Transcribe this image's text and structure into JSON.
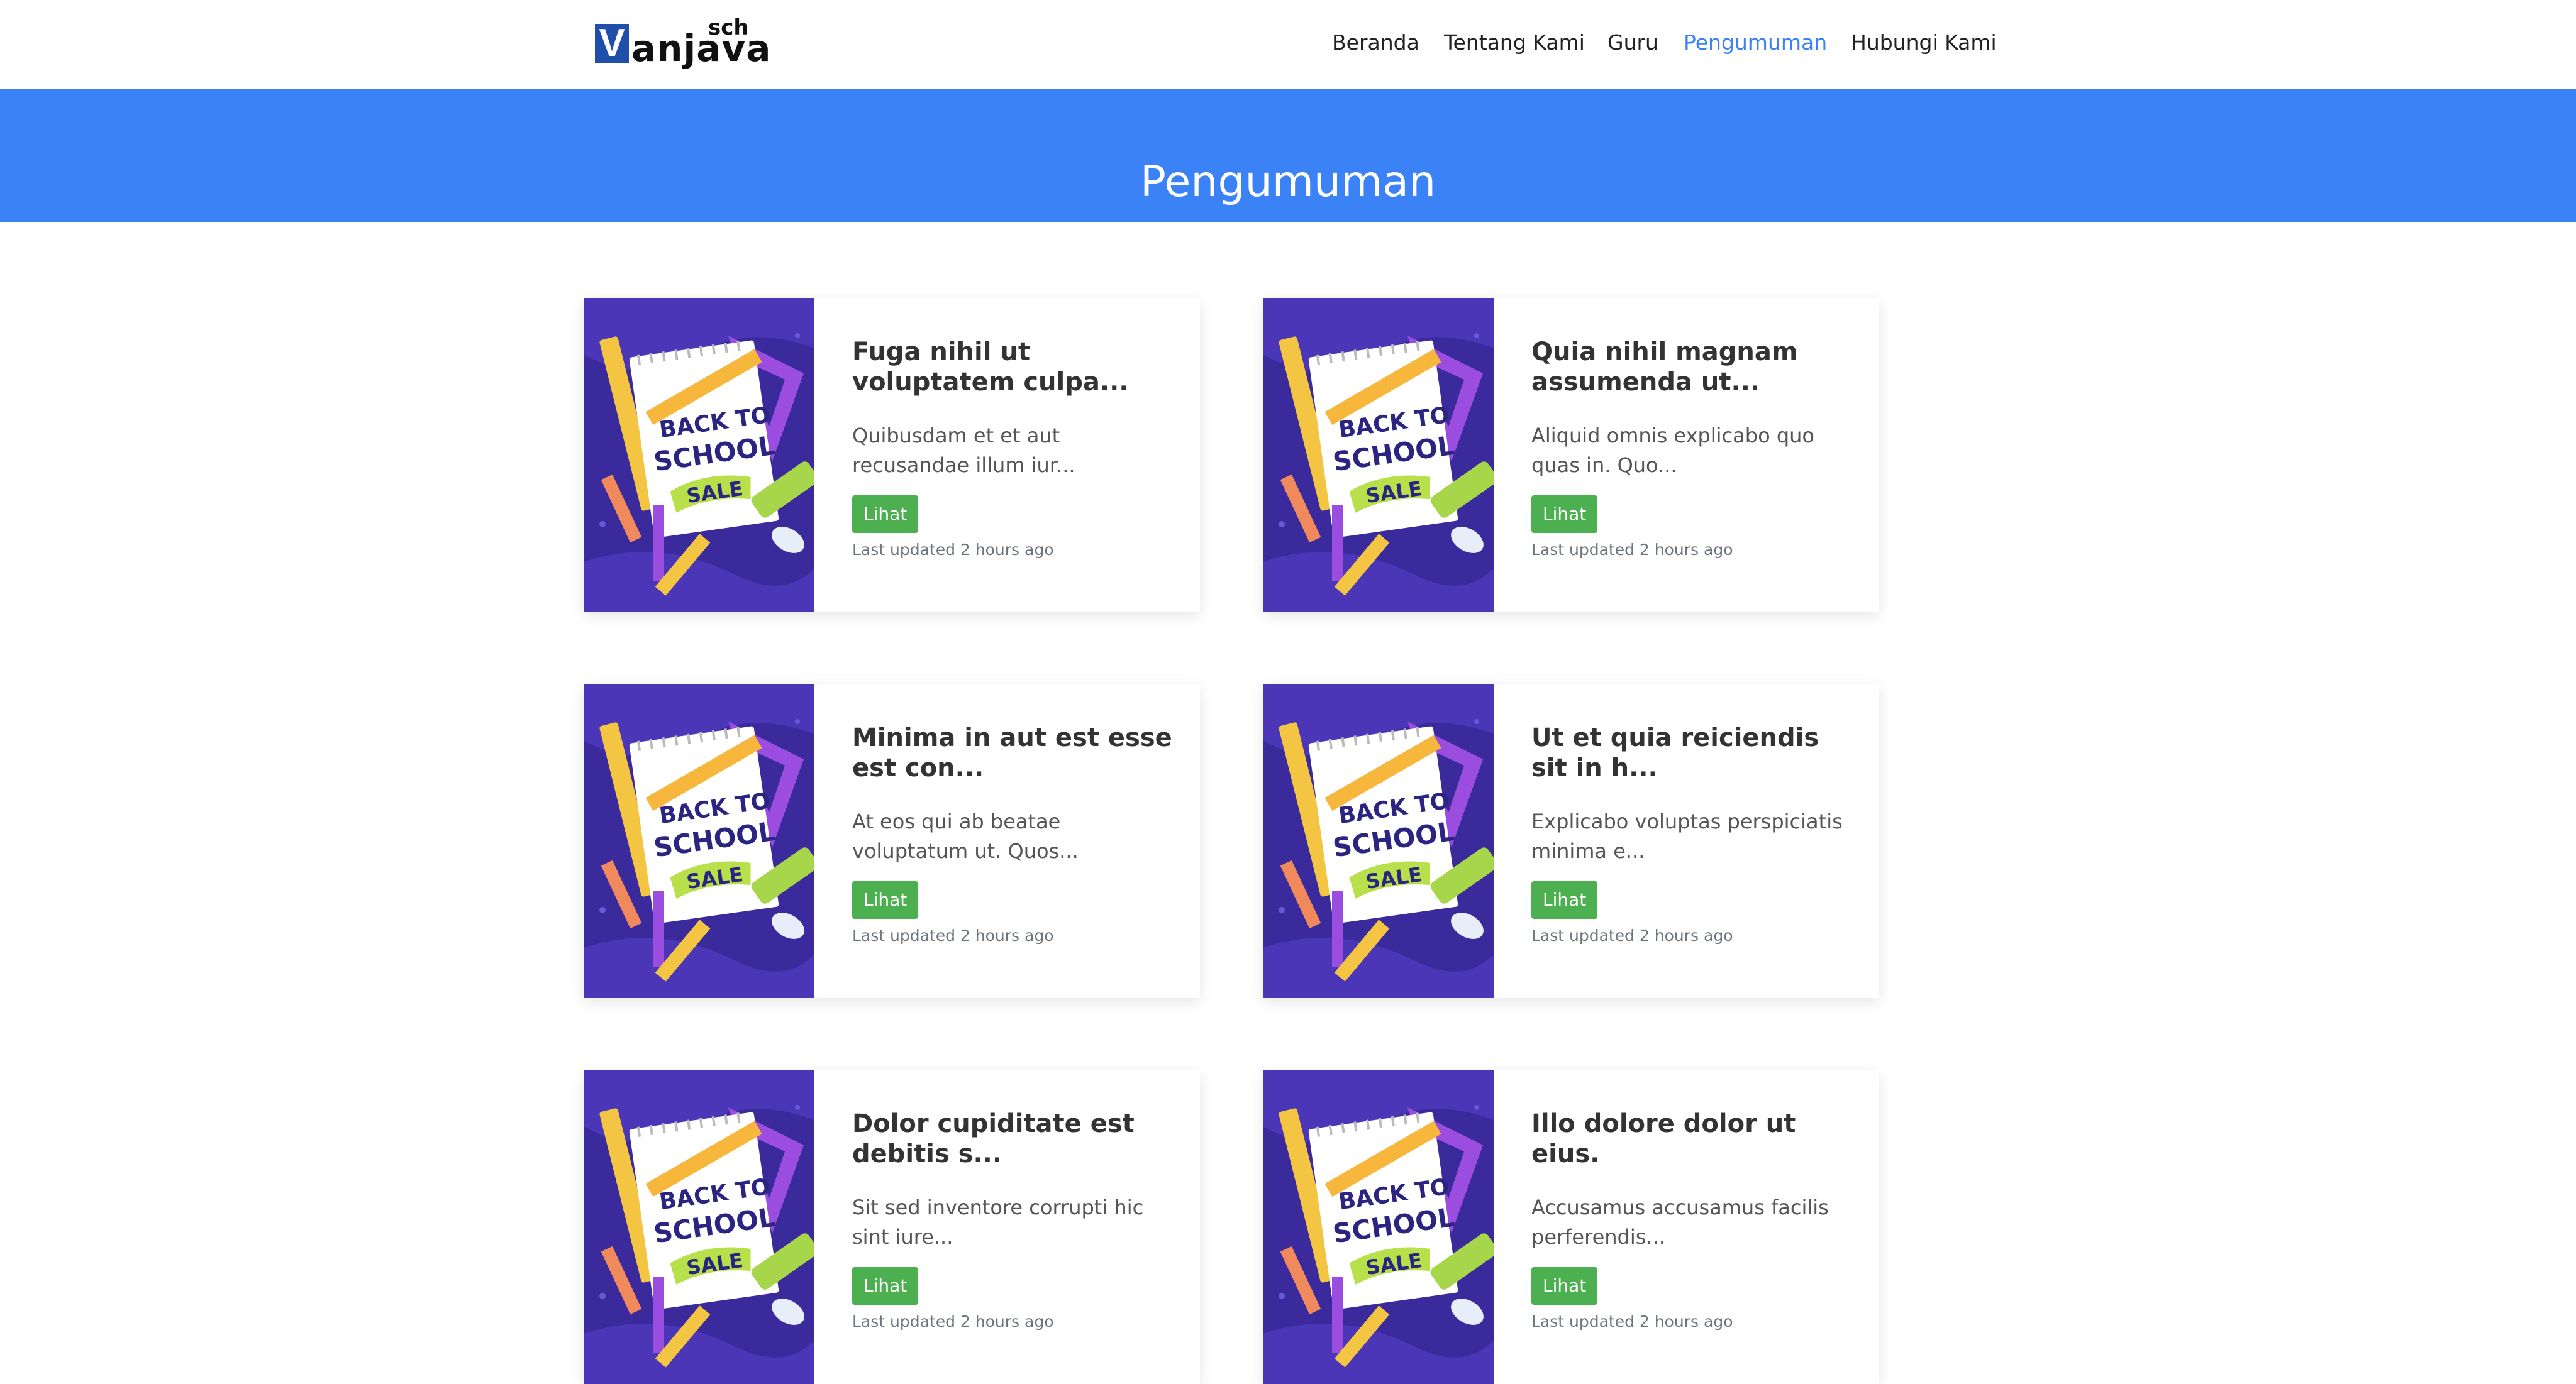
{
  "brand": {
    "logo_letter": "V",
    "logo_word": "anjava",
    "logo_suffix": "sch",
    "logo_color": "#1f4fa8"
  },
  "nav": {
    "items": [
      {
        "label": "Beranda",
        "active": false
      },
      {
        "label": "Tentang Kami",
        "active": false
      },
      {
        "label": "Guru",
        "active": false
      },
      {
        "label": "Pengumuman",
        "active": true
      },
      {
        "label": "Hubungi Kami",
        "active": false
      }
    ],
    "active_color": "#3b82f6"
  },
  "hero": {
    "title": "Pengumuman",
    "background": "#3b82f6"
  },
  "thumbnail": {
    "line1": "BACK TO",
    "line2": "SCHOOL",
    "line3": "SALE"
  },
  "posts": [
    {
      "title": "Fuga nihil ut voluptatem culpa...",
      "excerpt": "Quibusdam et et aut recusandae illum iur...",
      "button": "Lihat",
      "updated": "Last updated 2 hours ago"
    },
    {
      "title": "Quia nihil magnam assumenda ut...",
      "excerpt": "Aliquid omnis explicabo quo quas in. Quo...",
      "button": "Lihat",
      "updated": "Last updated 2 hours ago"
    },
    {
      "title": "Minima in aut est esse est con...",
      "excerpt": "At eos qui ab beatae voluptatum ut. Quos...",
      "button": "Lihat",
      "updated": "Last updated 2 hours ago"
    },
    {
      "title": "Ut et quia reiciendis sit in h...",
      "excerpt": "Explicabo voluptas perspiciatis minima e...",
      "button": "Lihat",
      "updated": "Last updated 2 hours ago"
    },
    {
      "title": "Dolor cupiditate est debitis s...",
      "excerpt": "Sit sed inventore corrupti hic sint iure...",
      "button": "Lihat",
      "updated": "Last updated 2 hours ago"
    },
    {
      "title": "Illo dolore dolor ut eius.",
      "excerpt": "Accusamus accusamus facilis perferendis...",
      "button": "Lihat",
      "updated": "Last updated 2 hours ago"
    }
  ],
  "button_color": "#4caf50"
}
